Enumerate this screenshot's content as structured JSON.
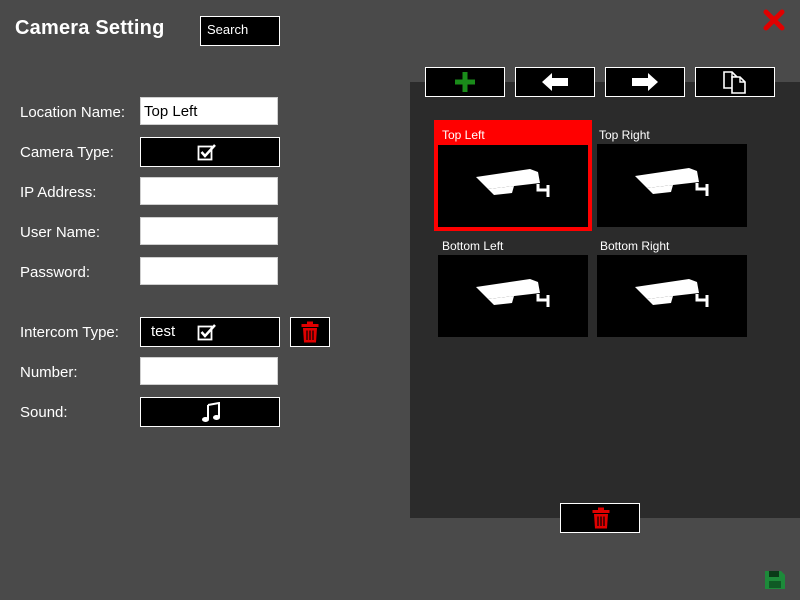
{
  "header": {
    "title": "Camera Setting",
    "search_label": "Search"
  },
  "form": {
    "location_label": "Location Name:",
    "location_value": "Top Left",
    "camera_type_label": "Camera Type:",
    "ip_label": "IP Address:",
    "ip_value": "",
    "user_label": "User Name:",
    "user_value": "",
    "password_label": "Password:",
    "password_value": "",
    "intercom_label": "Intercom Type:",
    "intercom_value": "test",
    "number_label": "Number:",
    "number_value": "",
    "sound_label": "Sound:"
  },
  "cameras": [
    {
      "label": "Top Left",
      "selected": true
    },
    {
      "label": "Top Right",
      "selected": false
    },
    {
      "label": "Bottom Left",
      "selected": false
    },
    {
      "label": "Bottom Right",
      "selected": false
    }
  ],
  "icons": {
    "close": "close-icon",
    "save": "save-icon",
    "add": "plus-icon",
    "prev": "arrow-left-icon",
    "next": "arrow-right-icon",
    "copy": "copy-icon",
    "delete": "trash-icon",
    "checkbox": "checkbox-icon",
    "sound": "music-note-icon",
    "camera": "security-camera-icon"
  },
  "colors": {
    "background": "#4a4a4a",
    "panel": "#2b2b2b",
    "selected": "#ff0000",
    "add_green": "#1a8c1a",
    "delete_red": "#e00000",
    "save_green": "#1d8a3a"
  }
}
